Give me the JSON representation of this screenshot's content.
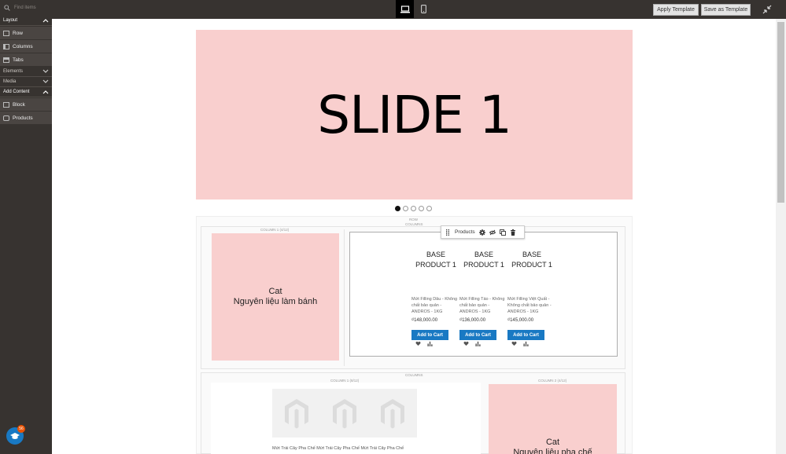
{
  "search": {
    "placeholder": "Find items"
  },
  "toolbar": {
    "apply_label": "Apply Template",
    "save_label": "Save as Template"
  },
  "panel": {
    "sections": {
      "layout": "Layout",
      "elements": "Elements",
      "media": "Media",
      "add_content": "Add Content"
    },
    "layout_items": [
      "Row",
      "Columns",
      "Tabs"
    ],
    "content_items": [
      "Block",
      "Products"
    ]
  },
  "help": {
    "badge": "56"
  },
  "slider": {
    "title": "SLIDE 1",
    "dots_count": 5,
    "active_dot": 0
  },
  "labels": {
    "row": "ROW",
    "columns": "COLUMNS",
    "column1": "COLUMN 1 (4/12)",
    "columns2": "COLUMNS",
    "column1b": "COLUMN 1 (8/12)",
    "column2b": "COLUMN 2 (4/12)"
  },
  "category_box": {
    "line1": "Cat",
    "line2": "Nguyên liệu làm bánh"
  },
  "products_toolbar": {
    "label": "Products"
  },
  "products": [
    {
      "name": "BASE PRODUCT 1",
      "desc": "Mứt Filling Dâu - Không chất bảo quản - ANDROS - 1KG",
      "price": "₫148,000.00",
      "cart": "Add to Cart"
    },
    {
      "name": "BASE PRODUCT 1",
      "desc": "Mứt Filling Táo - Không chất bảo quản - ANDROS - 1KG",
      "price": "₫136,000.00",
      "cart": "Add to Cart"
    },
    {
      "name": "BASE PRODUCT 1",
      "desc": "Mứt Filling Việt Quất - Không chất bảo quản - ANDROS - 1KG",
      "price": "₫145,000.00",
      "cart": "Add to Cart"
    }
  ],
  "second_row": {
    "strip_text": "Mứt Trái Cây Pha Chế Mứt Trái Cây Pha Chế Mứt Trái Cây Pha Chế",
    "cat_line1": "Cat",
    "cat_line2": "Nguyên liệu pha chế"
  },
  "colors": {
    "panel_bg": "#373330",
    "slide_bg": "#f9cfce",
    "accent": "#1979c3"
  }
}
